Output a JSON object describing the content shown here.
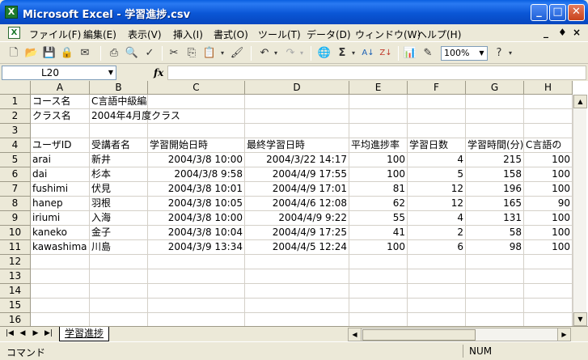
{
  "window": {
    "title": "Microsoft Excel - 学習進捗.csv",
    "min_glyph": "_",
    "max_glyph": "□",
    "close_glyph": "✕"
  },
  "menu": {
    "items": [
      "ファイル(F)",
      "編集(E)",
      "表示(V)",
      "挿入(I)",
      "書式(O)",
      "ツール(T)",
      "データ(D)",
      "ウィンドウ(W)",
      "ヘルプ(H)"
    ],
    "doc_min": "_",
    "doc_restore": "♦",
    "doc_close": "×"
  },
  "toolbar": {
    "icons": [
      "new-icon",
      "open-icon",
      "save-icon",
      "permission-icon",
      "email-icon",
      "print-icon",
      "print-preview-icon",
      "spelling-icon",
      "cut-icon",
      "copy-icon",
      "paste-icon",
      "format-painter-icon",
      "undo-icon",
      "redo-icon",
      "hyperlink-icon",
      "autosum-icon",
      "sort-asc-icon",
      "sort-desc-icon",
      "chart-wizard-icon",
      "drawing-icon",
      "help-icon"
    ],
    "zoom": "100%"
  },
  "formula_bar": {
    "name_box": "L20",
    "fx": "fx",
    "value": ""
  },
  "sheet": {
    "columns": [
      "A",
      "B",
      "C",
      "D",
      "E",
      "F",
      "G",
      "H"
    ],
    "row_numbers": [
      "1",
      "2",
      "3",
      "4",
      "5",
      "6",
      "7",
      "8",
      "9",
      "10",
      "11",
      "12",
      "13",
      "14",
      "15",
      "16"
    ],
    "rows": [
      [
        "コース名",
        "C言語中級編",
        "",
        "",
        "",
        "",
        "",
        ""
      ],
      [
        "クラス名",
        "2004年4月度クラス",
        "",
        "",
        "",
        "",
        "",
        ""
      ],
      [
        "",
        "",
        "",
        "",
        "",
        "",
        "",
        ""
      ],
      [
        "ユーザID",
        "受講者名",
        "学習開始日時",
        "最終学習日時",
        "平均進捗率",
        "学習日数",
        "学習時間(分)",
        "C言語の"
      ],
      [
        "arai",
        "新井",
        "2004/3/8 10:00",
        "2004/3/22 14:17",
        "100",
        "4",
        "215",
        "100"
      ],
      [
        "dai",
        "杉本",
        "2004/3/8 9:58",
        "2004/4/9 17:55",
        "100",
        "5",
        "158",
        "100"
      ],
      [
        "fushimi",
        "伏見",
        "2004/3/8 10:01",
        "2004/4/9 17:01",
        "81",
        "12",
        "196",
        "100"
      ],
      [
        "hanep",
        "羽根",
        "2004/3/8 10:05",
        "2004/4/6 12:08",
        "62",
        "12",
        "165",
        "90"
      ],
      [
        "iriumi",
        "入海",
        "2004/3/8 10:00",
        "2004/4/9 9:22",
        "55",
        "4",
        "131",
        "100"
      ],
      [
        "kaneko",
        "金子",
        "2004/3/8 10:04",
        "2004/4/9 17:25",
        "41",
        "2",
        "58",
        "100"
      ],
      [
        "kawashima",
        "川島",
        "2004/3/9 13:34",
        "2004/4/5 12:24",
        "100",
        "6",
        "98",
        "100"
      ],
      [
        "",
        "",
        "",
        "",
        "",
        "",
        "",
        ""
      ],
      [
        "",
        "",
        "",
        "",
        "",
        "",
        "",
        ""
      ],
      [
        "",
        "",
        "",
        "",
        "",
        "",
        "",
        ""
      ],
      [
        "",
        "",
        "",
        "",
        "",
        "",
        "",
        ""
      ],
      [
        "",
        "",
        "",
        "",
        "",
        "",
        "",
        ""
      ]
    ]
  },
  "tabs": {
    "sheets": [
      "学習進捗"
    ],
    "nav": [
      "|◀",
      "◀",
      "▶",
      "▶|"
    ]
  },
  "status": {
    "mode": "コマンド",
    "num": "NUM"
  }
}
